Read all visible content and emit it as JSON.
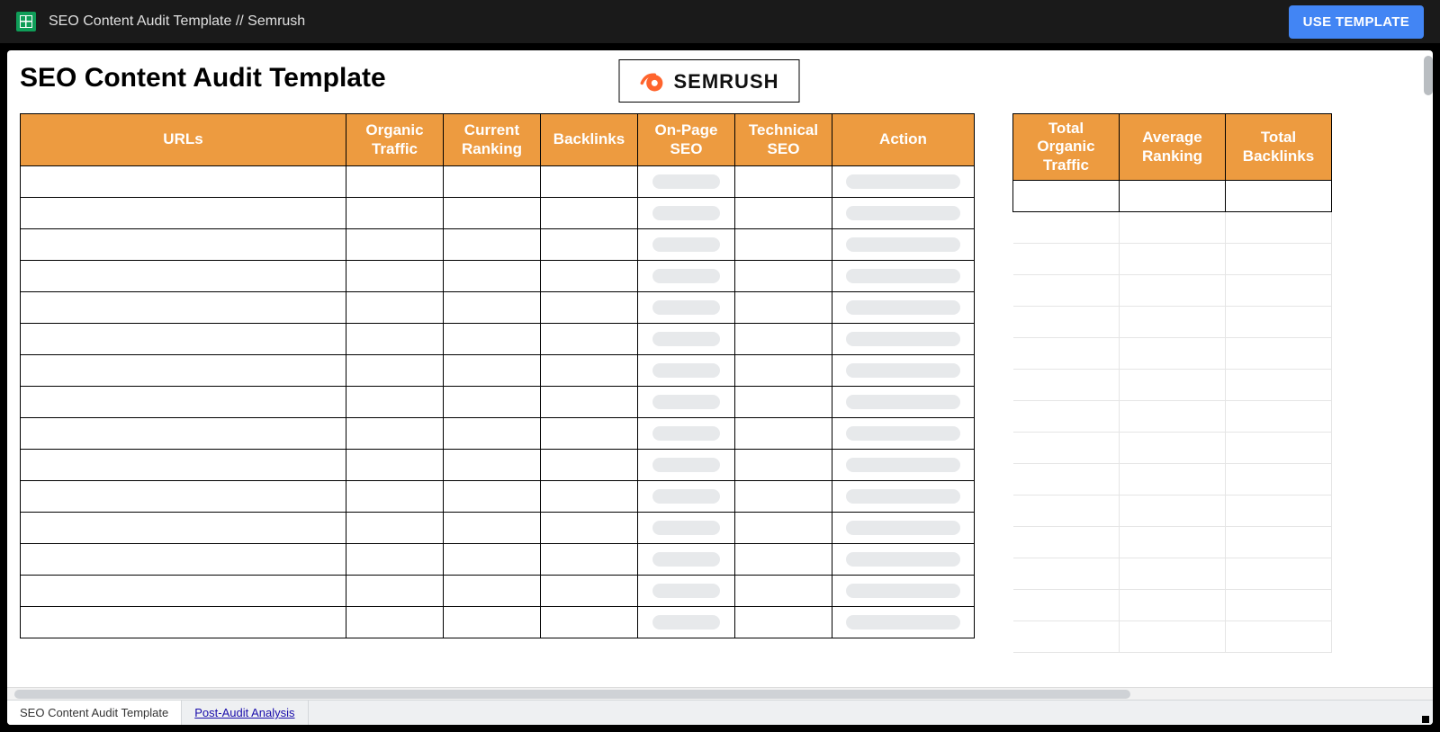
{
  "topbar": {
    "doc_title": "SEO Content Audit Template // Semrush",
    "use_template": "USE TEMPLATE"
  },
  "page": {
    "title": "SEO Content Audit Template",
    "brand": "SEMRUSH"
  },
  "main_table": {
    "headers": [
      "URLs",
      "Organic Traffic",
      "Current Ranking",
      "Backlinks",
      "On-Page SEO",
      "Technical SEO",
      "Action"
    ],
    "row_count": 15
  },
  "side_table": {
    "headers": [
      "Total Organic Traffic",
      "Average Ranking",
      "Total Backlinks"
    ],
    "row_count": 15
  },
  "tabs": {
    "active": "SEO Content Audit Template",
    "other": "Post-Audit Analysis"
  }
}
